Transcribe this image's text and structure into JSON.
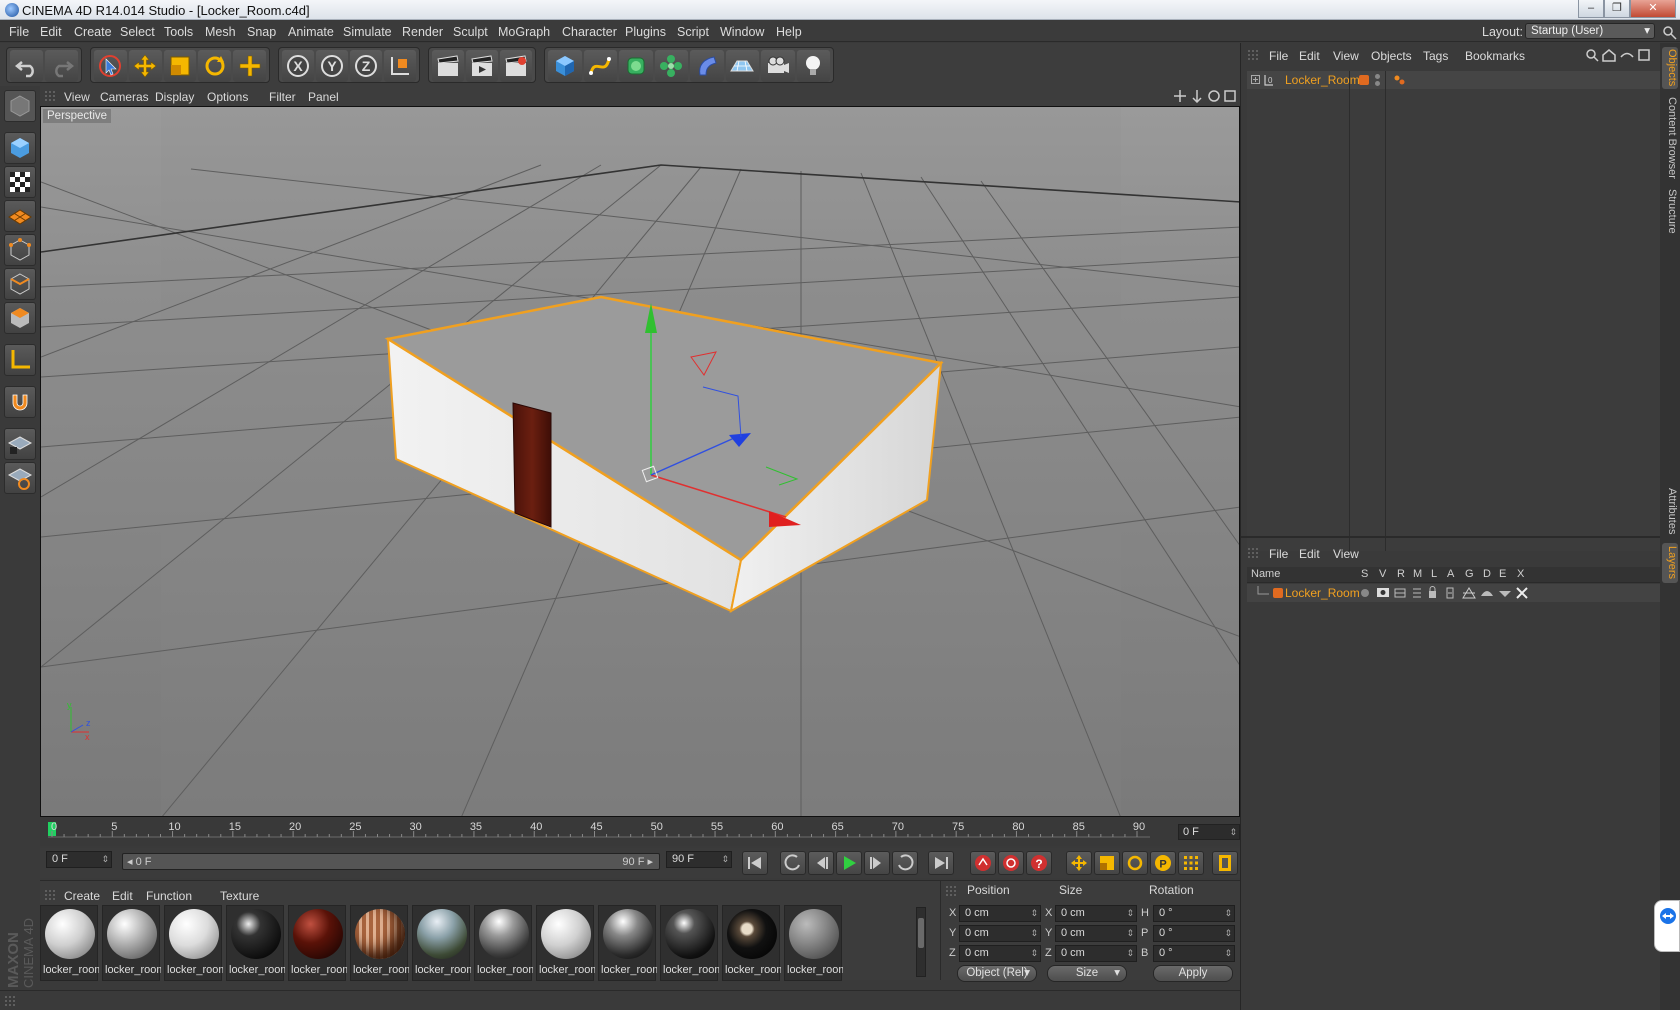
{
  "window": {
    "title": "CINEMA 4D R14.014 Studio - [Locker_Room.c4d]",
    "buttons": [
      "–",
      "❐",
      "✕"
    ]
  },
  "menubar": {
    "items": [
      "File",
      "Edit",
      "Create",
      "Select",
      "Tools",
      "Mesh",
      "Snap",
      "Animate",
      "Simulate",
      "Render",
      "Sculpt",
      "MoGraph",
      "Character",
      "Plugins",
      "Script",
      "Window",
      "Help"
    ],
    "layout_label": "Layout:",
    "layout_value": "Startup (User)"
  },
  "toolbar": {
    "axis_x": "X",
    "axis_y": "Y",
    "axis_z": "Z"
  },
  "viewport": {
    "menu": [
      "View",
      "Cameras",
      "Display",
      "Options",
      "Filter",
      "Panel"
    ],
    "label": "Perspective",
    "mini_axes": {
      "x": "x",
      "y": "y",
      "z": "z"
    }
  },
  "timeline": {
    "ticks": [
      "0",
      "5",
      "10",
      "15",
      "20",
      "25",
      "30",
      "35",
      "40",
      "45",
      "50",
      "55",
      "60",
      "65",
      "70",
      "75",
      "80",
      "85",
      "90"
    ],
    "current_frame": "0 F"
  },
  "transport": {
    "start_field": "0 F",
    "slider_start": "◂ 0 F",
    "slider_end": "90 F ▸",
    "end_field": "90 F"
  },
  "materials": {
    "menu": [
      "Create",
      "Edit",
      "Function",
      "Texture"
    ],
    "items": [
      "locker_room",
      "locker_room",
      "locker_room",
      "locker_room",
      "locker_room",
      "locker_room",
      "locker_room",
      "locker_room",
      "locker_room",
      "locker_room",
      "locker_room",
      "locker_room",
      "locker_room"
    ]
  },
  "coords": {
    "headers": [
      "Position",
      "Size",
      "Rotation"
    ],
    "pos": [
      "0 cm",
      "0 cm",
      "0 cm"
    ],
    "size": [
      "0 cm",
      "0 cm",
      "0 cm"
    ],
    "rot": [
      "0 °",
      "0 °",
      "0 °"
    ],
    "pos_axes": [
      "X",
      "Y",
      "Z"
    ],
    "size_axes": [
      "X",
      "Y",
      "Z"
    ],
    "rot_axes": [
      "H",
      "P",
      "B"
    ],
    "mode": "Object (Rel)",
    "size_mode": "Size",
    "apply": "Apply"
  },
  "objects_panel": {
    "menu": [
      "File",
      "Edit",
      "View",
      "Objects",
      "Tags",
      "Bookmarks"
    ],
    "object_name": "Locker_Room",
    "accent": "#f0a020"
  },
  "layers_panel": {
    "menu": [
      "File",
      "Edit",
      "View"
    ],
    "columns": [
      "Name",
      "S",
      "V",
      "R",
      "M",
      "L",
      "A",
      "G",
      "D",
      "E",
      "X"
    ],
    "layer_name": "Locker_Room"
  },
  "side_tabs": [
    "Objects",
    "Content Browser",
    "Structure",
    "Attributes",
    "Layers"
  ],
  "logo": {
    "brand1": "MAXON",
    "brand2": "CINEMA 4D"
  }
}
